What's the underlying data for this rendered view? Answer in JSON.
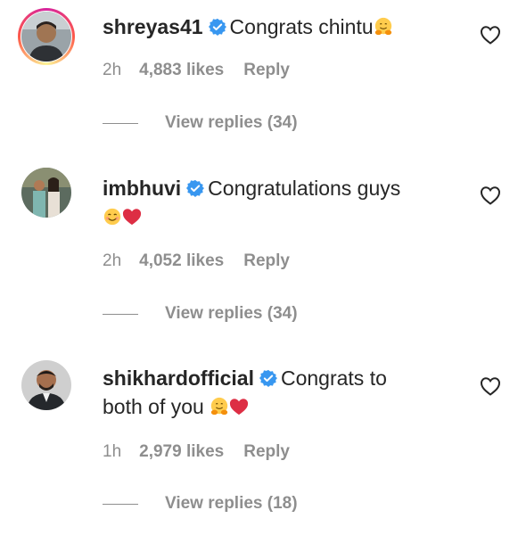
{
  "comments": [
    {
      "username": "shreyas41",
      "text": "Congrats chintu",
      "emojis": [
        "hug-emoji"
      ],
      "time": "2h",
      "likes": "4,883 likes",
      "reply_label": "Reply",
      "view_replies": "View replies (34)"
    },
    {
      "username": "imbhuvi",
      "text_line1": "Congratulations guys",
      "emojis": [
        "smile-emoji",
        "red-heart-emoji"
      ],
      "time": "2h",
      "likes": "4,052 likes",
      "reply_label": "Reply",
      "view_replies": "View replies (34)"
    },
    {
      "username": "shikhardofficial",
      "text_line1": "Congrats to",
      "text_line2": "both of you",
      "emojis": [
        "hug-emoji",
        "red-heart-emoji"
      ],
      "time": "1h",
      "likes": "2,979 likes",
      "reply_label": "Reply",
      "view_replies": "View replies (18)"
    }
  ],
  "colors": {
    "text": "#262626",
    "secondary": "#8e8e8e",
    "verified": "#3897f0",
    "heart": "#ed4956"
  }
}
